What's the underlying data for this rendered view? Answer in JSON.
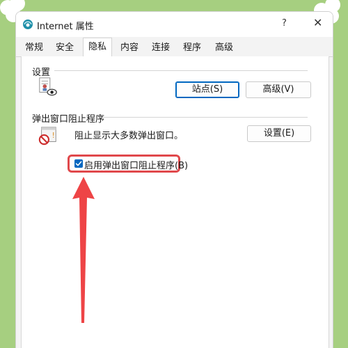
{
  "window": {
    "title": "Internet 属性",
    "help": "?",
    "close": "✕"
  },
  "tabs": [
    {
      "label": "常规",
      "active": false
    },
    {
      "label": "安全",
      "active": false
    },
    {
      "label": "隐私",
      "active": true
    },
    {
      "label": "内容",
      "active": false
    },
    {
      "label": "连接",
      "active": false
    },
    {
      "label": "程序",
      "active": false
    },
    {
      "label": "高级",
      "active": false
    }
  ],
  "settings": {
    "label": "设置",
    "sites_button": "站点(S)",
    "advanced_button": "高级(V)"
  },
  "popup_blocker": {
    "label": "弹出窗口阻止程序",
    "description": "阻止显示大多数弹出窗口。",
    "settings_button": "设置(E)",
    "enable_checkbox": {
      "label": "启用弹出窗口阻止程序(B)",
      "checked": true
    }
  },
  "annotation": {
    "highlight_color": "#e0484b",
    "arrow_color": "#ee4446"
  },
  "colors": {
    "background": "#a6cf80",
    "accent": "#0067c0"
  }
}
